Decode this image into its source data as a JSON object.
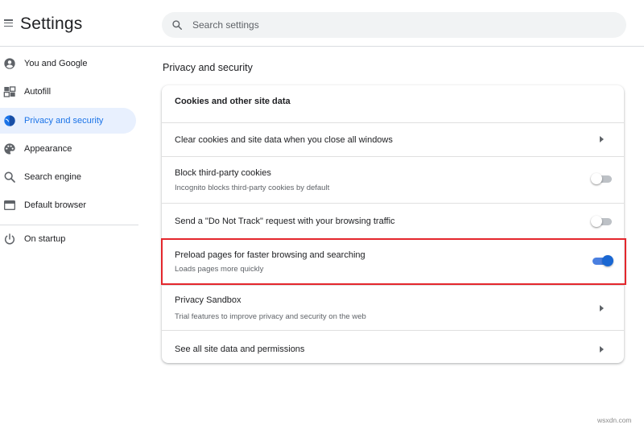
{
  "header": {
    "title": "Settings",
    "search_placeholder": "Search settings"
  },
  "sidebar": {
    "items": [
      {
        "label": "You and Google",
        "icon": "person-circle-icon",
        "active": false
      },
      {
        "label": "Autofill",
        "icon": "autofill-icon",
        "active": false
      },
      {
        "label": "Privacy and security",
        "icon": "shield-icon",
        "active": true
      },
      {
        "label": "Appearance",
        "icon": "palette-icon",
        "active": false
      },
      {
        "label": "Search engine",
        "icon": "search-icon",
        "active": false
      },
      {
        "label": "Default browser",
        "icon": "browser-window-icon",
        "active": false
      },
      {
        "label": "On startup",
        "icon": "power-icon",
        "active": false
      }
    ]
  },
  "main": {
    "section_title": "Privacy and security",
    "card": {
      "header": "Cookies and other site data",
      "rows": [
        {
          "title": "Clear cookies and site data when you close all windows",
          "subtitle": "",
          "control": "arrow"
        },
        {
          "title": "Block third-party cookies",
          "subtitle": "Incognito blocks third-party cookies by default",
          "control": "toggle",
          "checked": false
        },
        {
          "title": "Send a \"Do Not Track\" request with your browsing traffic",
          "subtitle": "",
          "control": "toggle",
          "checked": false
        },
        {
          "title": "Preload pages for faster browsing and searching",
          "subtitle": "Loads pages more quickly",
          "control": "toggle",
          "checked": true,
          "highlighted": true
        },
        {
          "title": "Privacy Sandbox",
          "subtitle": "Trial features to improve privacy and security on the web",
          "control": "arrow"
        },
        {
          "title": "See all site data and permissions",
          "subtitle": "",
          "control": "arrow"
        }
      ]
    }
  },
  "colors": {
    "accent": "#1a73e8",
    "active_nav_bg": "#e8f0fe",
    "highlight_border": "#e4272d",
    "toggle_on": "#1a67d2"
  },
  "watermark": "wsxdn.com"
}
